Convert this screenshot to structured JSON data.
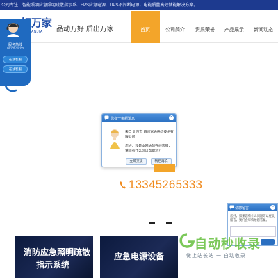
{
  "topbar": {
    "text": "公司专注：智能照明应急照明疏散指示系、EPS应急电源、UPS不间断电源，电能质量高效储能解决方案。"
  },
  "header": {
    "logo_text": "好万家",
    "logo_sub": "WANJIA",
    "slogan": "品动万好 质出万家"
  },
  "nav": {
    "items": [
      {
        "label": "首页",
        "active": true
      },
      {
        "label": "公司简介",
        "active": false
      },
      {
        "label": "资质荣誉",
        "active": false
      },
      {
        "label": "产品展示",
        "active": false
      },
      {
        "label": "新闻动态",
        "active": false
      }
    ]
  },
  "left_float": {
    "title": "服务热线",
    "hours": "09:00-18:00",
    "buttons": [
      "在线客服",
      "在线客服"
    ]
  },
  "contact": {
    "phone": "13345265333"
  },
  "popup": {
    "title": "您有一条新消息",
    "message1": "来自 北京市 圆创富通通信技术有限公司",
    "message2": "您好，我是本网站的在线客服，请问有什么可以帮助您？",
    "btn_chat": "立即交谈",
    "btn_later": "稍后再说"
  },
  "right_panel": {
    "title": "请您留言",
    "message": "您好，如果您有什么问题可以在此留言，我们会尽快给您答复。"
  },
  "banners": {
    "left_text_1": "消防应急照明疏散",
    "left_text_2": "指示系统",
    "mid_text": "应急电源设备"
  },
  "watermark": {
    "main": "自动秒收录",
    "sub": "做上站长站 一 自动收录"
  },
  "colors": {
    "brand_blue": "#1c4aa6",
    "accent_orange": "#f3a52a",
    "phone_orange": "#f08b1e",
    "chat_blue": "#2a6fc1"
  }
}
